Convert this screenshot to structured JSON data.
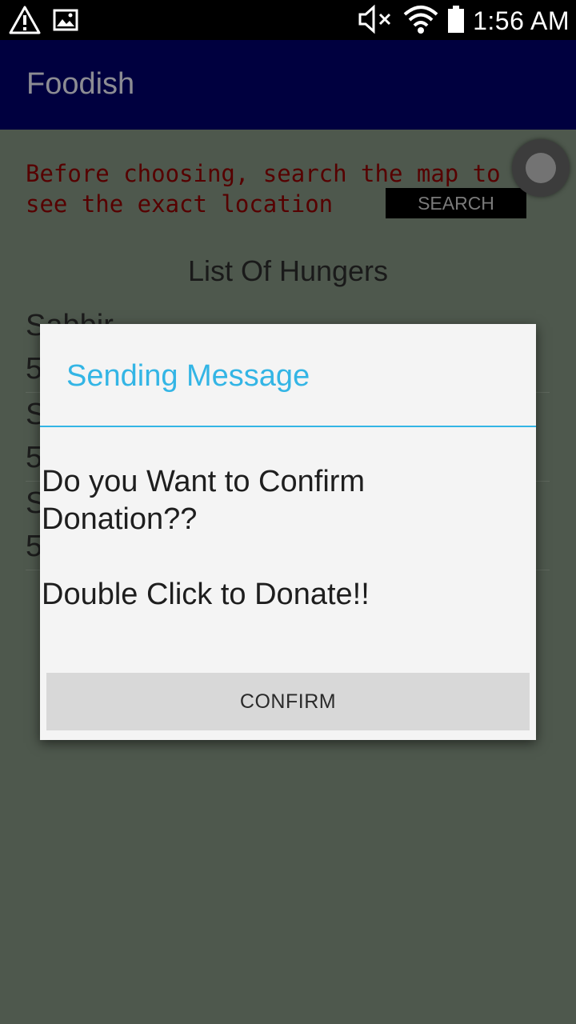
{
  "status_bar": {
    "time": "1:56 AM",
    "icons": [
      "warning-icon",
      "image-icon",
      "mute-icon",
      "wifi-icon",
      "battery-icon"
    ]
  },
  "app": {
    "title": "Foodish"
  },
  "main": {
    "hint_line1": "Before choosing, search the map to",
    "hint_line2": "see the exact location",
    "search_label": "SEARCH",
    "list_title": "List Of  Hungers",
    "items": [
      {
        "name": "Sabbir",
        "count": "5"
      },
      {
        "name": "S",
        "count": "5"
      },
      {
        "name": "S",
        "count": "5"
      }
    ]
  },
  "dialog": {
    "title": "Sending Message",
    "message": "Do you Want to Confirm\nDonation??\n\nDouble Click to Donate!!",
    "confirm_label": "CONFIRM"
  },
  "colors": {
    "app_bar": "#00003f",
    "dim_background": "#4e584d",
    "hint_text": "#560000",
    "dialog_accent": "#33b5e5"
  }
}
